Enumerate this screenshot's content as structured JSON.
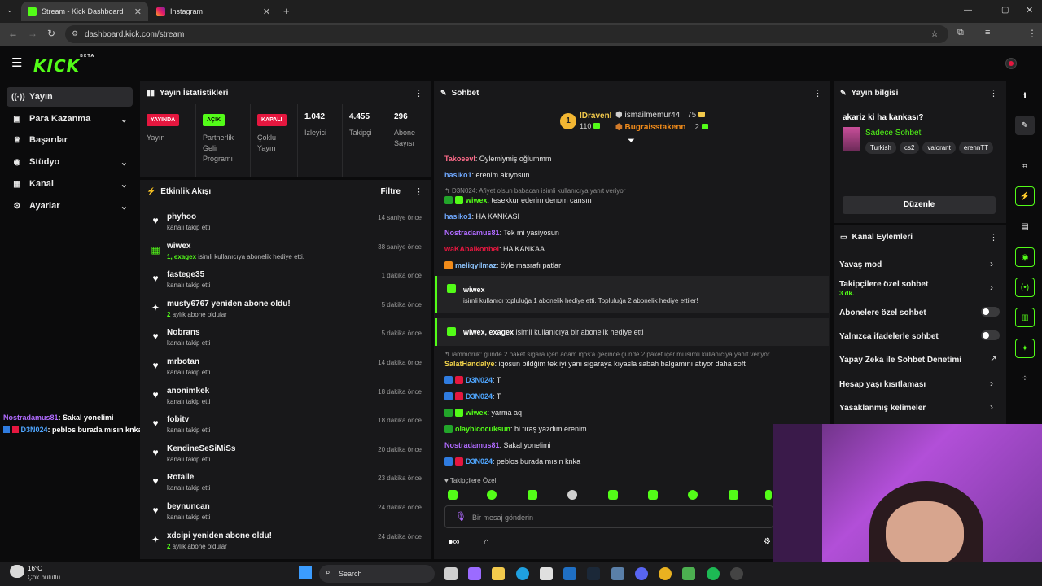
{
  "browser": {
    "tabs": [
      {
        "label": "Stream - Kick Dashboard",
        "active": true
      },
      {
        "label": "Instagram",
        "active": false
      }
    ],
    "url": "dashboard.kick.com/stream"
  },
  "app": {
    "logo": "KICK",
    "logo_badge": "BETA"
  },
  "sidebar": {
    "items": [
      {
        "label": "Yayın",
        "icon": "broadcast-icon"
      },
      {
        "label": "Para Kazanma",
        "icon": "money-icon"
      },
      {
        "label": "Başarılar",
        "icon": "trophy-icon"
      },
      {
        "label": "Stüdyo",
        "icon": "studio-icon"
      },
      {
        "label": "Kanal",
        "icon": "channel-icon"
      },
      {
        "label": "Ayarlar",
        "icon": "gear-icon"
      }
    ]
  },
  "overlay_chat": [
    {
      "user": "Nostradamus81",
      "text": ": Sakal yonelimi",
      "color": "#b06bff"
    },
    {
      "user": "D3N024",
      "text": ": peblos burada mısın knka",
      "color": "#4fa6ff"
    }
  ],
  "stats": {
    "title": "Yayın İstatistikleri",
    "cells": [
      {
        "badge": "YAYINDA",
        "label": "Yayın",
        "badge_color": "#e5173f"
      },
      {
        "badge": "AÇIK",
        "label": "Partnerlik Gelir Programı",
        "badge_color": "#53fc18"
      },
      {
        "badge": "KAPALI",
        "label": "Çoklu Yayın",
        "badge_color": "#e5173f"
      },
      {
        "value": "1.042",
        "label": "İzleyici"
      },
      {
        "value": "4.455",
        "label": "Takipçi"
      },
      {
        "value": "296",
        "label": "Abone Sayısı"
      }
    ]
  },
  "activity": {
    "title": "Etkinlik Akışı",
    "filter": "Filtre",
    "items": [
      {
        "icon": "heart-icon",
        "name": "phyhoo",
        "desc_hl": "",
        "desc": "kanalı takip etti",
        "time": "14 saniye önce"
      },
      {
        "icon": "gift-icon",
        "name": "wiwex",
        "desc_hl": "1, exagex",
        "desc": " isimli kullanıcıya abonelik hediye etti.",
        "time": "38 saniye önce"
      },
      {
        "icon": "heart-icon",
        "name": "fastege35",
        "desc_hl": "",
        "desc": "kanalı takip etti",
        "time": "1 dakika önce"
      },
      {
        "icon": "sparkle-icon",
        "name": "musty6767 yeniden abone oldu!",
        "desc_hl": "2",
        "desc": " aylık abone oldular",
        "time": "5 dakika önce"
      },
      {
        "icon": "heart-icon",
        "name": "Nobrans",
        "desc_hl": "",
        "desc": "kanalı takip etti",
        "time": "5 dakika önce"
      },
      {
        "icon": "heart-icon",
        "name": "mrbotan",
        "desc_hl": "",
        "desc": "kanalı takip etti",
        "time": "14 dakika önce"
      },
      {
        "icon": "heart-icon",
        "name": "anonimkek",
        "desc_hl": "",
        "desc": "kanalı takip etti",
        "time": "18 dakika önce"
      },
      {
        "icon": "heart-icon",
        "name": "fobitv",
        "desc_hl": "",
        "desc": "kanalı takip etti",
        "time": "18 dakika önce"
      },
      {
        "icon": "heart-icon",
        "name": "KendineSeSiMiSs",
        "desc_hl": "",
        "desc": "kanalı takip etti",
        "time": "20 dakika önce"
      },
      {
        "icon": "heart-icon",
        "name": "Rotalle",
        "desc_hl": "",
        "desc": "kanalı takip etti",
        "time": "23 dakika önce"
      },
      {
        "icon": "heart-icon",
        "name": "beynuncan",
        "desc_hl": "",
        "desc": "kanalı takip etti",
        "time": "24 dakika önce"
      },
      {
        "icon": "sparkle-icon",
        "name": "xdcipi yeniden abone oldu!",
        "desc_hl": "2",
        "desc": " aylık abone oldular",
        "time": "24 dakika önce"
      }
    ]
  },
  "chat": {
    "title": "Sohbet",
    "leaders": {
      "first": {
        "rank": "1",
        "name": "IDravenI",
        "count": "110"
      },
      "second": {
        "name": "ismailmemur44",
        "count": "75"
      },
      "third": {
        "name": "Bugraisstakenn",
        "count": "2"
      }
    },
    "messages": [
      {
        "user": "Takoeevl",
        "text": ": Öylemiymiş oğlummm",
        "color": "#ff6b8a",
        "badges": []
      },
      {
        "user": "hasiko1",
        "text": ": erenim akıyosun",
        "color": "#6fa8ff",
        "badges": []
      },
      {
        "reply": "D3N024: Afiyet olsun babacan isimli kullanıcıya yanıt veriyor"
      },
      {
        "user": "wiwex",
        "text": ": tesekkur ederim denom cansın",
        "color": "#53fc18",
        "badges": [
          "#22a52a",
          "#53fc18"
        ]
      },
      {
        "user": "hasiko1",
        "text": ": HA KANKASI",
        "color": "#6fa8ff",
        "badges": []
      },
      {
        "user": "Nostradamus81",
        "text": ": Tek mi yasiyosun",
        "color": "#b06bff",
        "badges": []
      },
      {
        "user": "waKAbalkonbel",
        "text": ": HA KANKAA",
        "color": "#e5173f",
        "badges": []
      },
      {
        "user": "meliqyilmaz",
        "text": ": öyle masrafı patlar",
        "color": "#8ec5ff",
        "badges": [
          "#f08b1a"
        ]
      }
    ],
    "gifts": [
      {
        "name": "wiwex",
        "text": "isimli kullanıcı topluluğa 1 abonelik hediye etti. Topluluğa 2 abonelik hediye ettiler!"
      },
      {
        "name": "wiwex",
        "name2": "exagex",
        "text": "isimli kullanıcıya bir abonelik hediye etti"
      }
    ],
    "messages2": [
      {
        "reply": "iammoruk: günde 2 paket sigara içen adam iqos'a geçince günde 2 paket içer mi isimli kullanıcıya yanıt veriyor"
      },
      {
        "user": "SalatHandalye",
        "text": ": iqosun bildğim tek iyi yanı sigaraya kıyasla sabah balgamını atıyor daha soft",
        "color": "#f1d34a",
        "badges": []
      },
      {
        "user": "D3N024",
        "text": ": T",
        "color": "#4fa6ff",
        "badges": [
          "#2f7ce0",
          "#e5173f"
        ]
      },
      {
        "user": "D3N024",
        "text": ": T",
        "color": "#4fa6ff",
        "badges": [
          "#2f7ce0",
          "#e5173f"
        ]
      },
      {
        "user": "wiwex",
        "text": ": yarma aq",
        "color": "#53fc18",
        "badges": [
          "#22a52a",
          "#53fc18"
        ]
      },
      {
        "user": "olaybicocuksun",
        "text": ": bi tıraş yazdım erenim",
        "color": "#53fc18",
        "badges": [
          "#22a52a"
        ]
      },
      {
        "user": "Nostradamus81",
        "text": ": Sakal yonelimi",
        "color": "#b06bff",
        "badges": []
      },
      {
        "user": "D3N024",
        "text": ": peblos burada mısın knka",
        "color": "#4fa6ff",
        "badges": [
          "#2f7ce0",
          "#e5173f"
        ]
      }
    ],
    "emote_header": "Takipçilere Özel",
    "input_placeholder": "Bir mesaj gönderin"
  },
  "stream_info": {
    "title": "Yayın bilgisi",
    "stream_title": "akariz ki ha kankası?",
    "category": "Sadece Sohbet",
    "tags": [
      "Turkish",
      "cs2",
      "valorant",
      "erennTT"
    ],
    "edit_button": "Düzenle"
  },
  "channel_actions": {
    "title": "Kanal Eylemleri",
    "items": [
      {
        "label": "Yavaş mod",
        "control": "chevron"
      },
      {
        "label": "Takipçilere özel sohbet",
        "sub": "3 dk.",
        "control": "chevron"
      },
      {
        "label": "Abonelere özel sohbet",
        "control": "toggle"
      },
      {
        "label": "Yalnızca ifadelerle sohbet",
        "control": "toggle"
      },
      {
        "label": "Yapay Zeka ile Sohbet Denetimi",
        "control": "external"
      },
      {
        "label": "Hesap yaşı kısıtlaması",
        "control": "chevron"
      },
      {
        "label": "Yasaklanmış kelimeler",
        "control": "chevron"
      }
    ]
  },
  "taskbar": {
    "weather_temp": "16°C",
    "weather_desc": "Çok bulutlu",
    "search": "Search"
  },
  "colors": {
    "accent": "#53fc18",
    "panel": "#18181a",
    "bg": "#0b0b0c"
  }
}
